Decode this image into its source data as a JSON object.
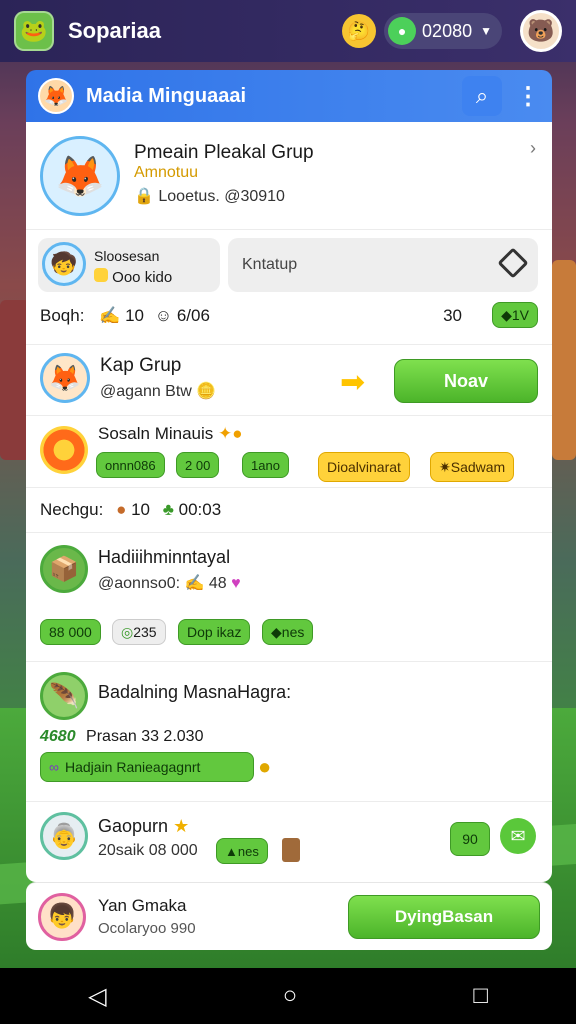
{
  "app": {
    "name": "Sopariaa",
    "currency_value": "02080"
  },
  "header": {
    "title": "Madia Minguaaai"
  },
  "profile": {
    "name": "Pmeain Pleakal Grup",
    "rank": "Amnotuu",
    "stat": "Looetus. @30910"
  },
  "tabs": {
    "left_title": "Sloosesan",
    "left_sub": "Ooo kido",
    "right_label": "Kntatup"
  },
  "stats_row": {
    "label": "Boqh:",
    "val1": "10",
    "val2": "6/06",
    "right_num": "30",
    "right_badge": "1V"
  },
  "group": {
    "name": "Kap Grup",
    "handle": "@agann Btw",
    "button": "Noav"
  },
  "social": {
    "title": "Sosaln Minauis",
    "chips": [
      "onnn086",
      "2 00",
      "1ano"
    ],
    "btn1": "Dioalvinarat",
    "btn2": "Sadwam"
  },
  "neighbour": {
    "label": "Nechgu:",
    "val1": "10",
    "val2": "00:03"
  },
  "hadith": {
    "title": "Hadiiihminntayal",
    "handle": "@aonnso0:",
    "count": "48",
    "chips": [
      "88 000",
      "235",
      "Dop ikaz",
      "nes"
    ]
  },
  "badal": {
    "title": "Badalning MasnaHagra:",
    "code": "4680",
    "meta": "Prasan 33 2.030",
    "bar": "Hadjain Ranieagagnrt"
  },
  "gomum": {
    "name": "Gaopurn",
    "meta": "20saik 08 000",
    "chip": "nes",
    "num": "90"
  },
  "footer": {
    "name": "Yan Gmaka",
    "sub": "Ocolaryoo 990",
    "button": "DyingBasan"
  }
}
